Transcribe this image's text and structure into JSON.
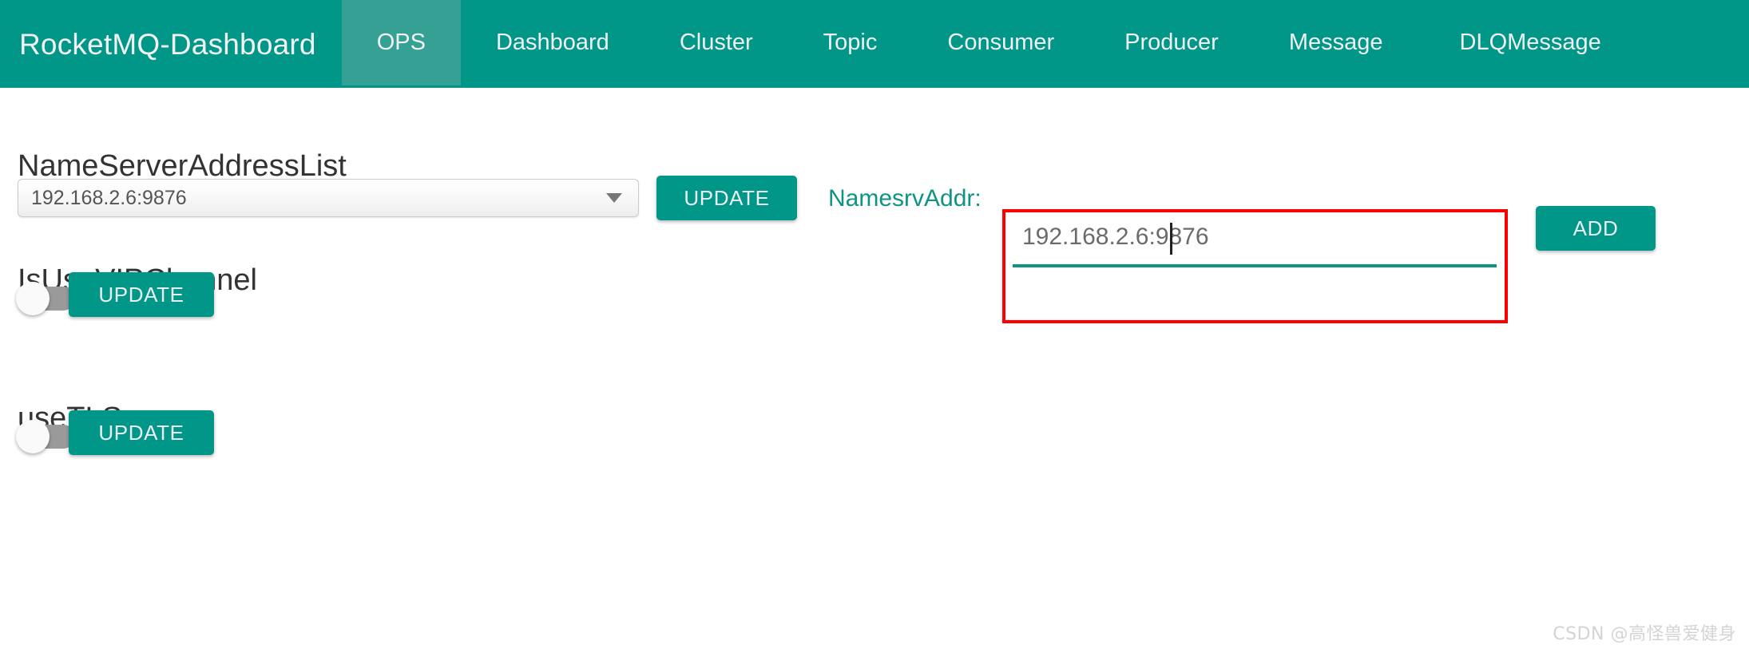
{
  "navbar": {
    "brand": "RocketMQ-Dashboard",
    "background_color": "#009688",
    "active_background_color": "#35a195",
    "items": [
      {
        "label": "OPS",
        "active": true
      },
      {
        "label": "Dashboard",
        "active": false
      },
      {
        "label": "Cluster",
        "active": false
      },
      {
        "label": "Topic",
        "active": false
      },
      {
        "label": "Consumer",
        "active": false
      },
      {
        "label": "Producer",
        "active": false
      },
      {
        "label": "Message",
        "active": false
      },
      {
        "label": "DLQMessage",
        "active": false
      }
    ]
  },
  "sections": {
    "nameserver": {
      "title": "NameServerAddressList",
      "select_value": "192.168.2.6:9876",
      "update_label": "UPDATE",
      "namesrv_label": "NamesrvAddr:",
      "input_value": "192.168.2.6:9876",
      "input_placeholder": "",
      "add_label": "ADD",
      "highlight_color": "#ff0000",
      "accent_color": "#0e9384"
    },
    "vip_channel": {
      "title": "IsUseVIPChannel",
      "toggle_state": "off",
      "update_label": "UPDATE"
    },
    "use_tls": {
      "title": "useTLS",
      "toggle_state": "off",
      "update_label": "UPDATE"
    }
  },
  "watermark": "CSDN @高怪兽爱健身"
}
